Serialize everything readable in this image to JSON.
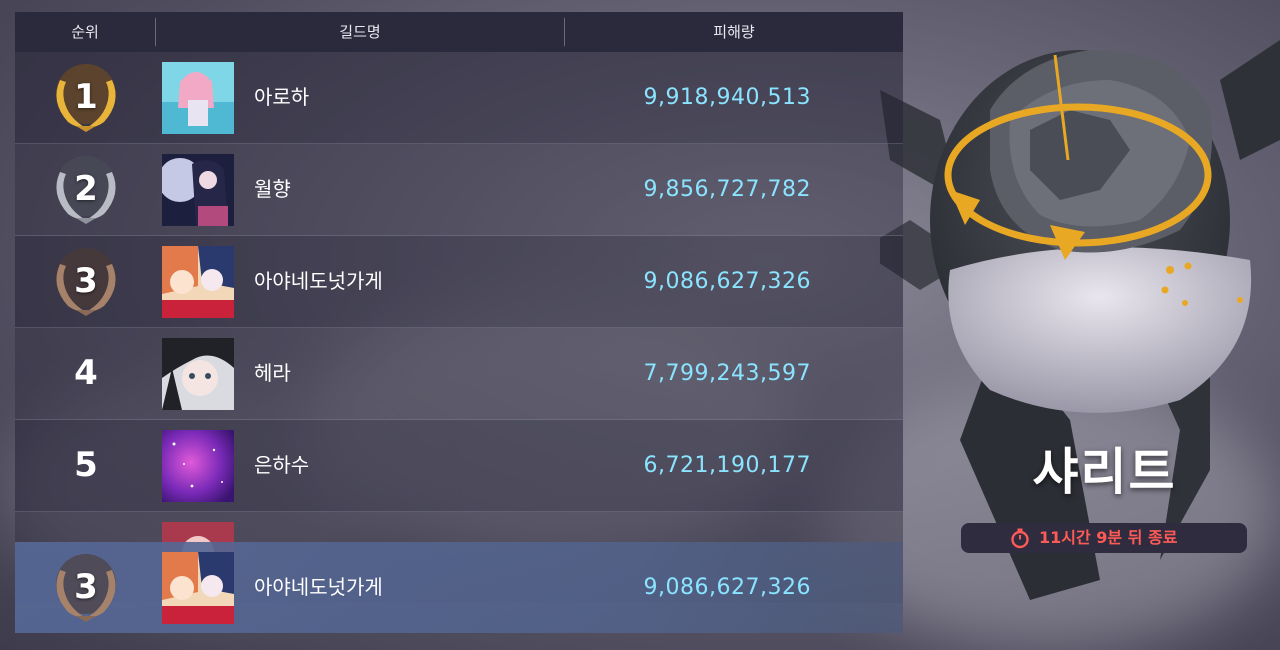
{
  "header": {
    "rank": "순위",
    "guild": "길드명",
    "damage": "피해량"
  },
  "rows": [
    {
      "rank": "1",
      "medal": "gold",
      "guild": "아로하",
      "damage": "9,918,940,513"
    },
    {
      "rank": "2",
      "medal": "silver",
      "guild": "월향",
      "damage": "9,856,727,782"
    },
    {
      "rank": "3",
      "medal": "bronze",
      "guild": "아야네도넛가게",
      "damage": "9,086,627,326"
    },
    {
      "rank": "4",
      "medal": "",
      "guild": "헤라",
      "damage": "7,799,243,597"
    },
    {
      "rank": "5",
      "medal": "",
      "guild": "은하수",
      "damage": "6,721,190,177"
    }
  ],
  "my_guild": {
    "rank": "3",
    "medal": "bronze",
    "guild": "아야네도넛가게",
    "damage": "9,086,627,326"
  },
  "boss": {
    "name": "샤리트",
    "timer": "11시간 9분 뒤 종료"
  },
  "colors": {
    "gold": "#e8b43a",
    "silver": "#b9bcc4",
    "bronze": "#a7826a",
    "damage_text": "#8be4ff",
    "timer_text": "#ff5a56",
    "header_bg": "#2b2a3c"
  },
  "icons": [
    "laurel-medal-icon",
    "stopwatch-icon",
    "guild-avatar"
  ]
}
